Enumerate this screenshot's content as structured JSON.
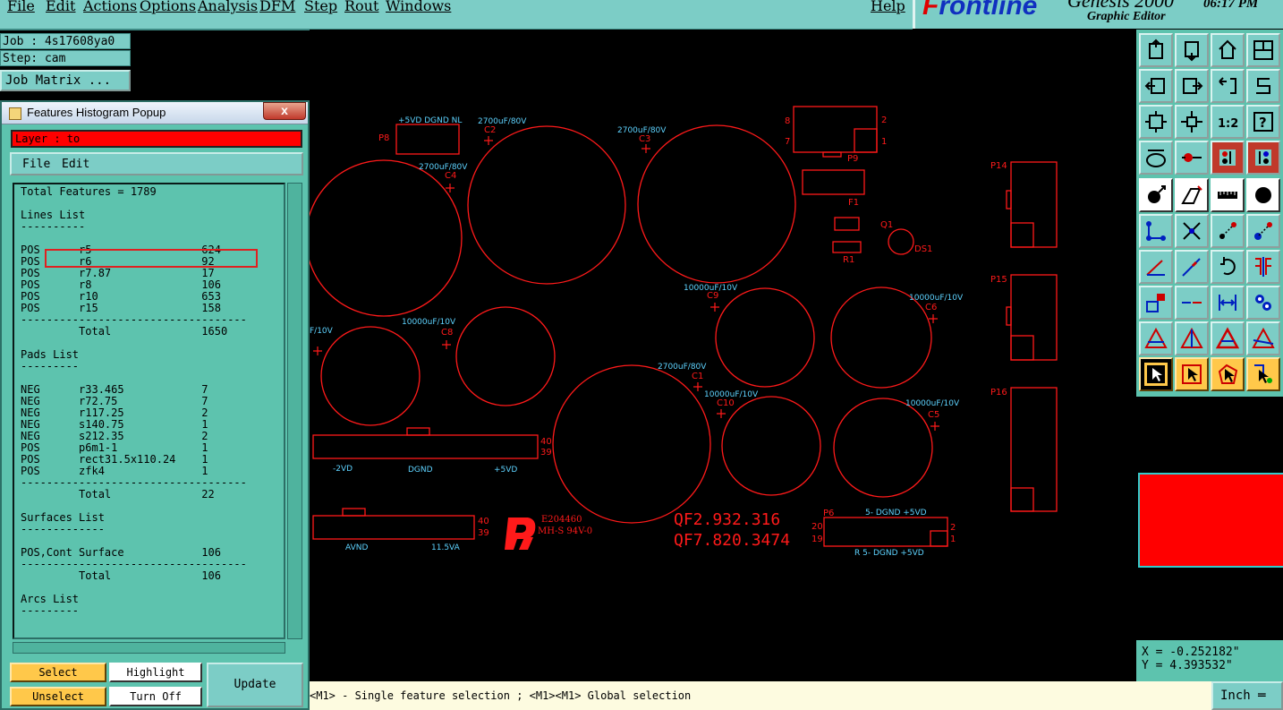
{
  "menu": {
    "items": [
      "File",
      "Edit",
      "Actions",
      "Options",
      "Analysis",
      "DFM",
      "Step",
      "Rout",
      "Windows"
    ],
    "help": "Help"
  },
  "brand": {
    "logo": "Frontline",
    "product": "Genesis 2000",
    "subtitle": "Graphic Editor",
    "time": "06:17 PM"
  },
  "job": {
    "job_label": "Job : 4s17608ya0",
    "step_label": "Step: cam",
    "matrix_button": "Job Matrix ..."
  },
  "popup": {
    "title": "Features Histogram Popup",
    "close": "x",
    "layer": "Layer :  to",
    "menu": [
      "File",
      "Edit"
    ],
    "content": "Total Features = 1789\n\nLines List\n----------\n\nPOS      r5                 624\nPOS      r6                 92\nPOS      r7.87              17\nPOS      r8                 106\nPOS      r10                653\nPOS      r15                158\n-----------------------------------\n         Total              1650\n\nPads List\n---------\n\nNEG      r33.465            7\nNEG      r72.75             7\nNEG      r117.25            2\nNEG      s140.75            1\nNEG      s212.35            2\nPOS      p6m1-1             1\nPOS      rect31.5x110.24    1\nPOS      zfk4               1\n-----------------------------------\n         Total              22\n\nSurfaces List\n-------------\n\nPOS,Cont Surface            106\n-----------------------------------\n         Total              106\n\nArcs List\n---------",
    "buttons": {
      "select": "Select",
      "highlight": "Highlight",
      "unselect": "Unselect",
      "turn_off": "Turn Off",
      "update": "Update"
    }
  },
  "canvas": {
    "labels": {
      "p8": "P8",
      "p8_nets": "+5VD DGND NL",
      "c2": "C2",
      "c2_val": "2700uF/80V",
      "c3": "C3",
      "c3_val": "2700uF/80V",
      "c4": "C4",
      "c4_val": "2700uF/80V",
      "c8": "C8",
      "c8_val": "10000uF/10V",
      "c9": "C9",
      "c9_val": "10000uF/10V",
      "c6": "C6",
      "c6_val": "10000uF/10V",
      "c1": "C1",
      "c1_val": "2700uF/80V",
      "c10": "C10",
      "c10_val": "10000uF/10V",
      "c5": "C5",
      "c5_val": "10000uF/10V",
      "c7_val": "F/10V",
      "p9": "P9",
      "f1": "F1",
      "q1": "Q1",
      "r1": "R1",
      "ds1": "DS1",
      "p14": "P14",
      "p15": "P15",
      "p16": "P16",
      "p6": "P6",
      "qf1": "QF2.932.316",
      "qf2": "QF7.820.3474",
      "e_num": "E204460",
      "e_rating": "MH-S 94V-0",
      "conn_a": "-2VD",
      "conn_b": "DGND",
      "conn_c": "+5VD",
      "conn_d": "AVND",
      "conn_e": "11.5VA",
      "p6_top": "5- DGND  +5VD",
      "p6_bot": "R 5- DGND  +5VD",
      "n40a": "40",
      "n39a": "39",
      "n40b": "40",
      "n39b": "39",
      "n20": "20",
      "n19": "19",
      "n2": "2",
      "n1": "1",
      "p9_8": "8",
      "p9_7": "7",
      "p9_2": "2",
      "p9_1": "1"
    }
  },
  "status": {
    "message": "<M1> - Single feature selection ; <M1><M1> Global selection",
    "unit": "Inch ═"
  },
  "coords": {
    "x": "X = -0.252182\"",
    "y": "Y = 4.393532\""
  },
  "colors": {
    "panel": "#5dc3ae",
    "menubar": "#7ccdc6",
    "accent_red": "#ff0000",
    "button_yellow": "#ffc84a",
    "silk_cyan": "#5ed3ff"
  }
}
